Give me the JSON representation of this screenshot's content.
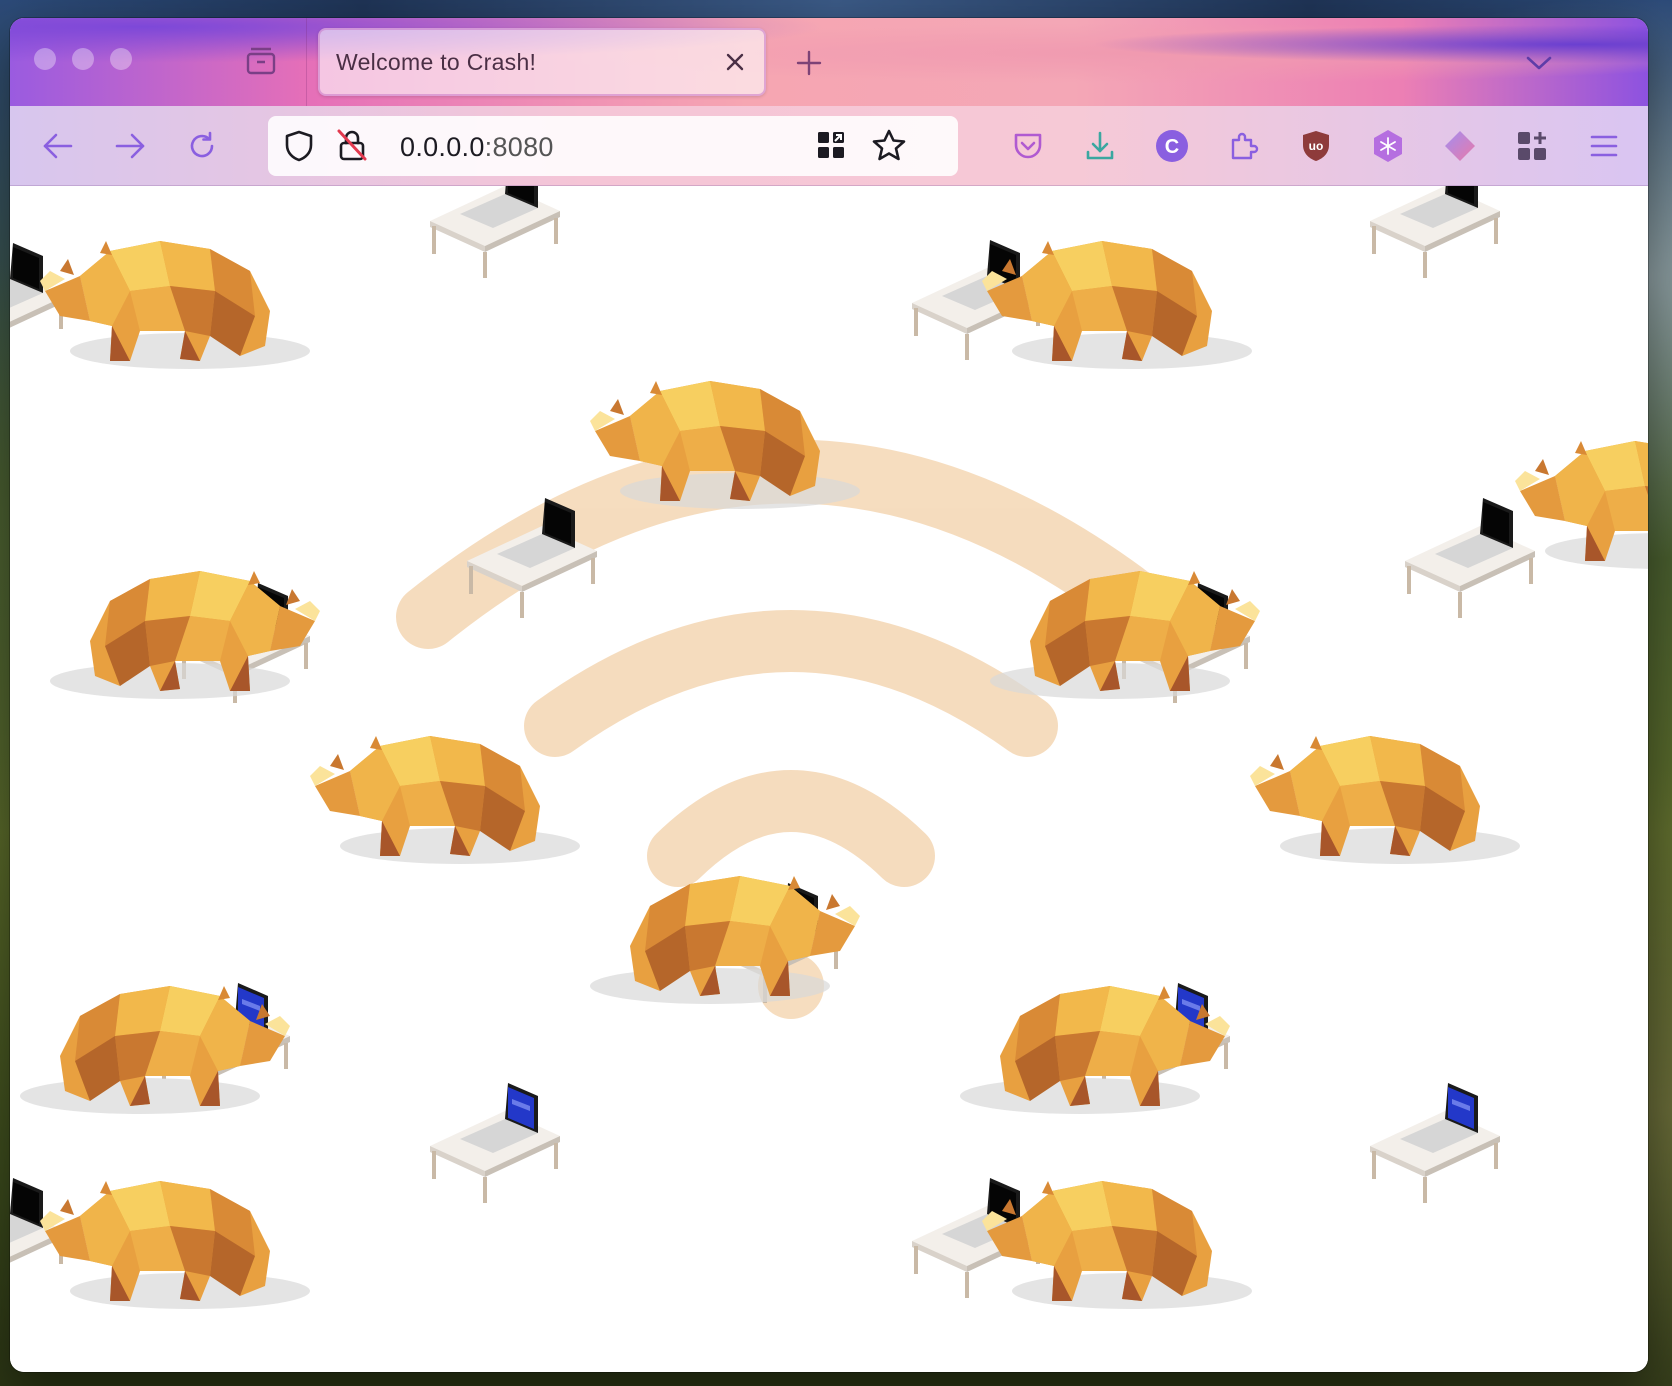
{
  "tab": {
    "title": "Welcome to Crash!",
    "close_icon": "close-icon"
  },
  "toolbar": {
    "back_icon": "arrow-left-icon",
    "forward_icon": "arrow-right-icon",
    "reload_icon": "reload-icon",
    "tracking_protection_icon": "shield-icon",
    "insecure_icon": "lock-slash-icon",
    "qr_icon": "qr-code-icon",
    "bookmark_icon": "star-icon",
    "pocket_icon": "pocket-icon",
    "downloads_icon": "download-icon",
    "account_icon": "account-c-icon",
    "account_letter": "C",
    "extensions_icon": "puzzle-icon",
    "ublock_icon": "ublock-icon",
    "snowflake_icon": "snowflake-icon",
    "diamond_icon": "diamond-icon",
    "apps_icon": "apps-grid-icon",
    "menu_icon": "hamburger-menu-icon"
  },
  "address": {
    "host": "0.0.0.0",
    "port": ":8080"
  },
  "colors": {
    "accent": "#8a5fe0",
    "wifi": "#f5d9b8",
    "rhino_light": "#f4c45a",
    "rhino_dark": "#b8672a"
  },
  "page": {
    "wifi_icon": "wifi-icon",
    "sprite_rhino": "rhino",
    "sprite_laptop": "laptop-on-desk"
  }
}
